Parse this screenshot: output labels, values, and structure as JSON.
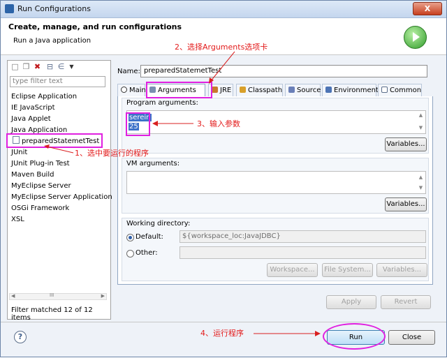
{
  "window": {
    "title": "Run Configurations",
    "close_label": "X"
  },
  "header": {
    "title": "Create, manage, and run configurations",
    "subtitle": "Run a Java application"
  },
  "left": {
    "filter_placeholder": "type filter text",
    "items": [
      "Eclipse Application",
      "IE JavaScript",
      "Java Applet",
      "Java Application",
      "preparedStatemetTest",
      "JUnit",
      "JUnit Plug-in Test",
      "Maven Build",
      "MyEclipse Server",
      "MyEclipse Server Application",
      "OSGi Framework",
      "XSL"
    ],
    "scroll_label": "III",
    "status": "Filter matched 12 of 12 items"
  },
  "config": {
    "name_label": "Name:",
    "name_value": "preparedStatemetTest",
    "tabs": [
      "Main",
      "Arguments",
      "JRE",
      "Classpath",
      "Source",
      "Environment",
      "Common"
    ],
    "program_args_label": "Program arguments:",
    "program_args": [
      "serein",
      "25"
    ],
    "variables_label": "Variables...",
    "vm_args_label": "VM arguments:",
    "working_dir_label": "Working directory:",
    "default_label": "Default:",
    "default_value": "${workspace_loc:JavaJDBC}",
    "other_label": "Other:",
    "workspace_btn": "Workspace...",
    "filesystem_btn": "File System...",
    "variables_btn": "Variables...",
    "apply": "Apply",
    "revert": "Revert"
  },
  "footer": {
    "help": "?",
    "run": "Run",
    "close": "Close"
  },
  "annotations": {
    "step1": "1、选中要运行的程序",
    "step2": "2、选择Arguments选项卡",
    "step3": "3、输入参数",
    "step4": "4、运行程序"
  },
  "colors": {
    "highlight": "#e020e0",
    "annotation": "#e31b1b",
    "selection": "#3d72c9"
  }
}
